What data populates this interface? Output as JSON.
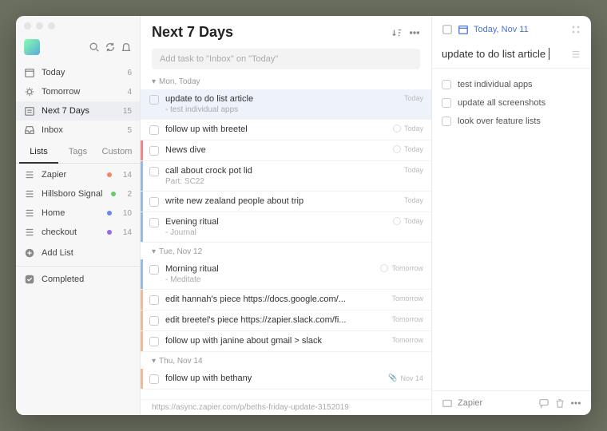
{
  "sidebar": {
    "smart": [
      {
        "icon": "calendar",
        "label": "Today",
        "count": 6
      },
      {
        "icon": "sun",
        "label": "Tomorrow",
        "count": 4
      },
      {
        "icon": "week",
        "label": "Next 7 Days",
        "count": 15,
        "active": true
      },
      {
        "icon": "inbox",
        "label": "Inbox",
        "count": 5
      }
    ],
    "tabs": [
      "Lists",
      "Tags",
      "Custom"
    ],
    "lists": [
      {
        "label": "Zapier",
        "dot": "red",
        "count": 14
      },
      {
        "label": "Hillsboro Signal",
        "dot": "green",
        "count": 2
      },
      {
        "label": "Home",
        "dot": "blue",
        "count": 10
      },
      {
        "label": "checkout",
        "dot": "purple",
        "count": 14
      }
    ],
    "addList": "Add List",
    "completed": "Completed"
  },
  "main": {
    "title": "Next 7 Days",
    "addPlaceholder": "Add task to \"Inbox\" on \"Today\"",
    "groups": [
      {
        "header": "Mon, Today",
        "tasks": [
          {
            "title": "update to do list article",
            "sub": "- test individual apps",
            "trail": "Today",
            "bar": "",
            "selected": true,
            "clock": false
          },
          {
            "title": "follow up with breetel",
            "trail": "Today",
            "bar": "",
            "clock": true
          },
          {
            "title": "News dive",
            "trail": "Today",
            "bar": "red",
            "clock": true
          },
          {
            "title": "call about crock pot lid",
            "sub": "Part: SC22",
            "trail": "Today",
            "bar": "blue"
          },
          {
            "title": "write new zealand people about trip",
            "trail": "Today",
            "bar": "blue"
          },
          {
            "title": "Evening ritual",
            "sub": "- Journal",
            "trail": "Today",
            "bar": "blue",
            "clock": true
          }
        ]
      },
      {
        "header": "Tue, Nov 12",
        "tasks": [
          {
            "title": "Morning ritual",
            "sub": "- Meditate",
            "trail": "Tomorrow",
            "bar": "blue",
            "clock": true
          },
          {
            "title": "edit hannah's piece https://docs.google.com/...",
            "trail": "Tomorrow",
            "bar": "orange"
          },
          {
            "title": "edit breetel's piece https://zapier.slack.com/fi...",
            "trail": "Tomorrow",
            "bar": "orange"
          },
          {
            "title": "follow up with janine about gmail > slack",
            "trail": "Tomorrow",
            "bar": "orange"
          }
        ]
      },
      {
        "header": "Thu, Nov 14",
        "tasks": [
          {
            "title": "follow up with bethany",
            "trail": "Nov 14",
            "bar": "orange",
            "attach": true
          }
        ]
      }
    ],
    "cutoff": "https://async.zapier.com/p/beths-friday-update-3152019"
  },
  "detail": {
    "date": "Today, Nov 11",
    "title": "update to do list article",
    "subtasks": [
      "test individual apps",
      "update all screenshots",
      "look over feature lists"
    ],
    "list": "Zapier"
  }
}
